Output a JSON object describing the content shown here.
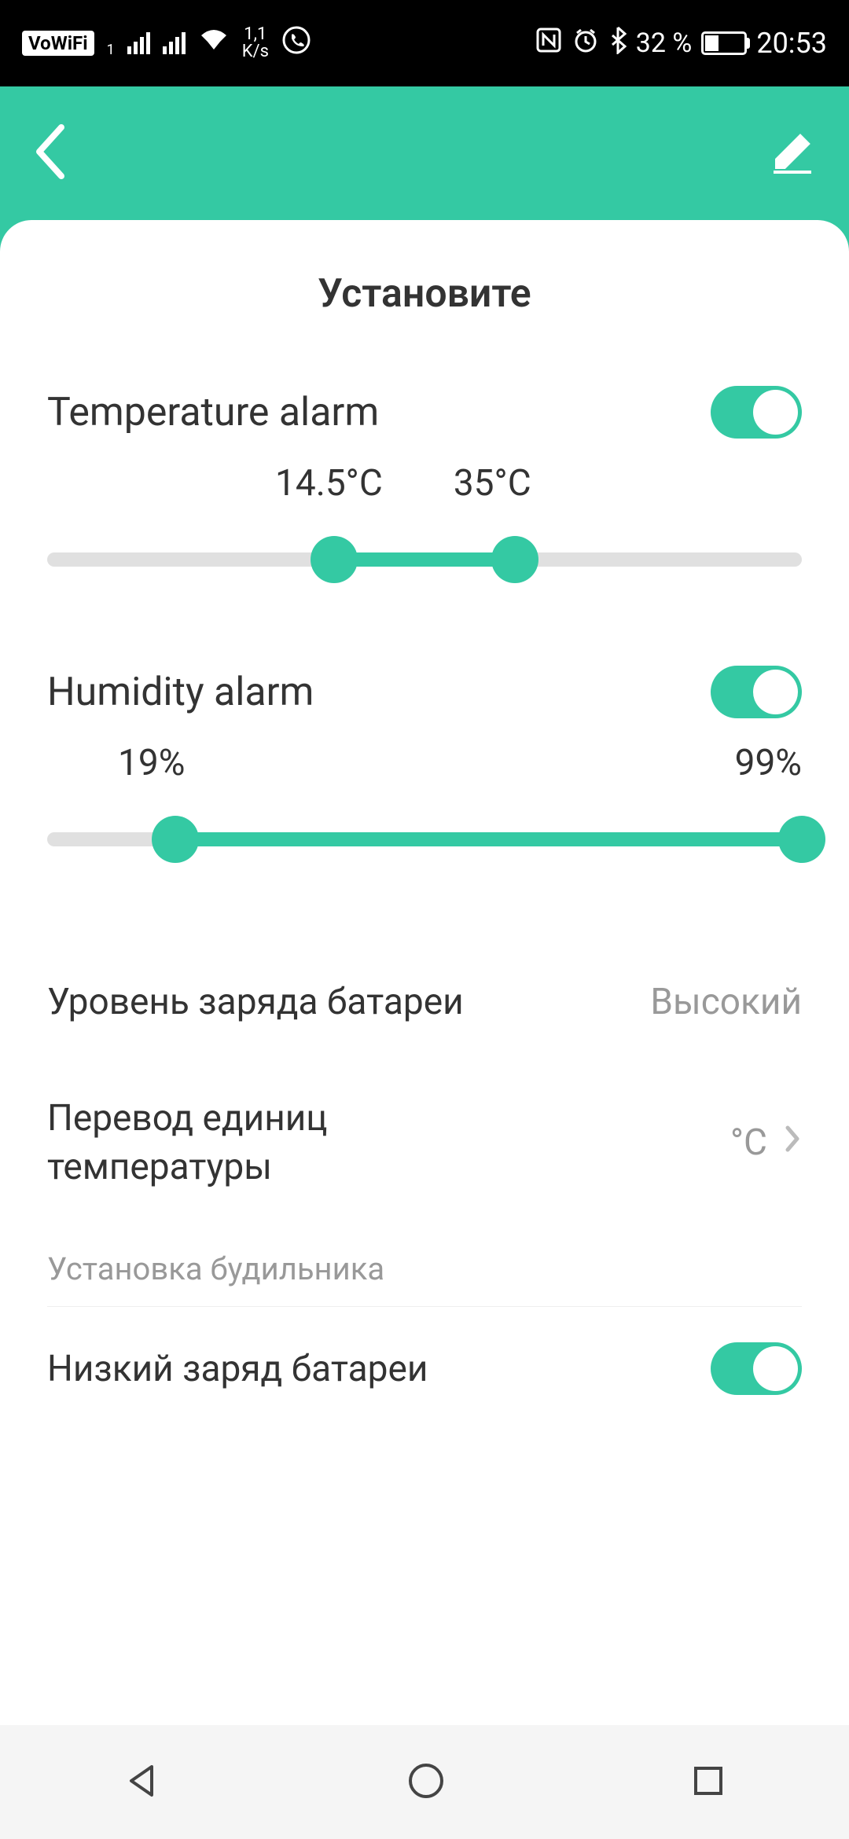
{
  "status_bar": {
    "vowifi": "VoWiFi",
    "data_rate": "1,1",
    "data_unit": "K/s",
    "battery_percent": "32 %",
    "time": "20:53"
  },
  "page_title": "Установите",
  "temperature": {
    "label": "Temperature alarm",
    "enabled": true,
    "min_label": "14.5°C",
    "max_label": "35°C",
    "min_pct": 38,
    "max_pct": 62
  },
  "humidity": {
    "label": "Humidity alarm",
    "enabled": true,
    "min_label": "19%",
    "max_label": "99%",
    "min_pct": 19,
    "max_pct": 99
  },
  "battery_level": {
    "label": "Уровень заряда батареи",
    "value": "Высокий"
  },
  "temp_units": {
    "label": "Перевод единиц температуры",
    "value": "°C"
  },
  "alarm_section_header": "Установка будильника",
  "low_battery": {
    "label": "Низкий заряд батареи",
    "enabled": true
  }
}
